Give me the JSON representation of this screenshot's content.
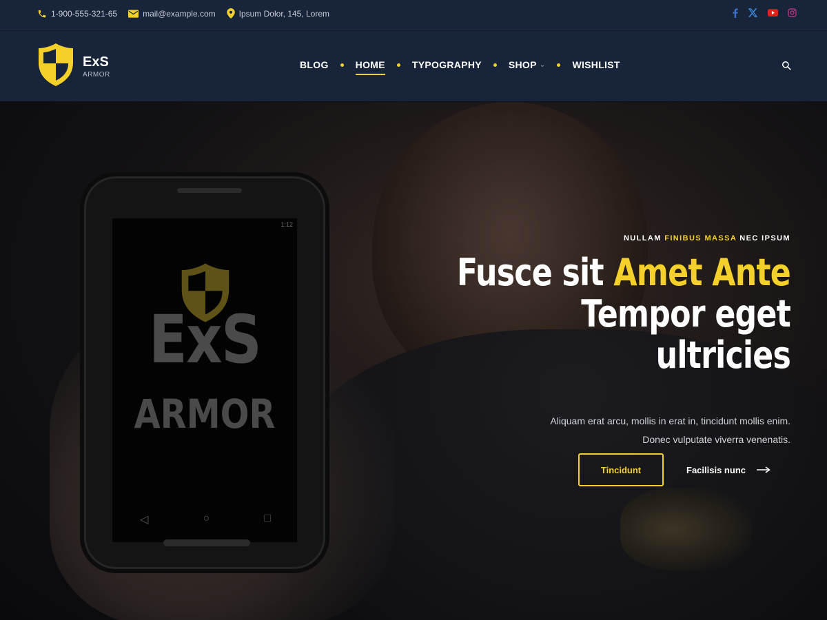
{
  "topbar": {
    "phone": "1-900-555-321-65",
    "email": "mail@example.com",
    "address": "Ipsum Dolor, 145, Lorem",
    "social": [
      {
        "icon": "facebook-icon",
        "color": "#3b6fc9"
      },
      {
        "icon": "x-icon",
        "color": "#3b8ee0"
      },
      {
        "icon": "youtube-icon",
        "color": "#e0221a"
      },
      {
        "icon": "instagram-icon",
        "color": "#c13584"
      }
    ]
  },
  "brand": {
    "name": "ExS",
    "sub": "ARMOR",
    "accent": "#f4d02a"
  },
  "nav": {
    "items": [
      {
        "label": "BLOG",
        "active": false
      },
      {
        "label": "HOME",
        "active": true
      },
      {
        "label": "TYPOGRAPHY",
        "active": false
      },
      {
        "label": "SHOP",
        "active": false,
        "has_dropdown": true
      },
      {
        "label": "WISHLIST",
        "active": false
      }
    ]
  },
  "hero": {
    "eyebrow_pre": "NULLAM ",
    "eyebrow_highlight": "FINIBUS MASSA",
    "eyebrow_post": " NEC IPSUM",
    "headline_line1_pre": "Fusce sit ",
    "headline_line1_highlight": "Amet Ante",
    "headline_line2": "Tempor eget ultricies",
    "description_line1": "Aliquam erat arcu, mollis in erat in, tincidunt mollis enim.",
    "description_line2": "Donec vulputate viverra venenatis.",
    "primary_button": "Tincidunt",
    "secondary_button": "Facilisis nunc",
    "phone_screen": {
      "time": "1:12",
      "brand_line1": "ExS",
      "brand_line2": "ARMOR"
    }
  }
}
